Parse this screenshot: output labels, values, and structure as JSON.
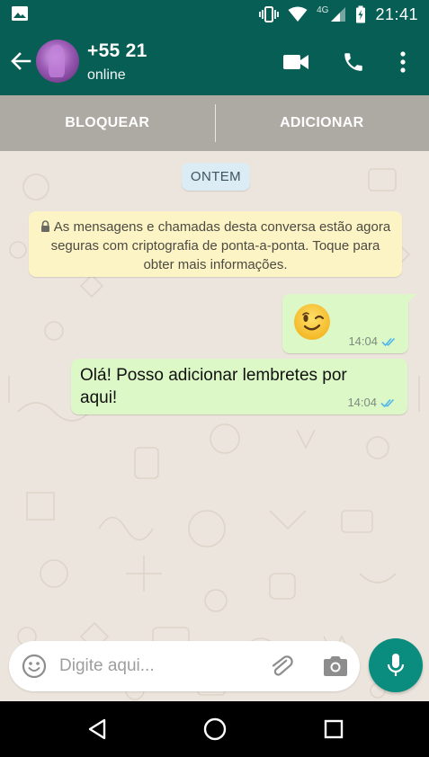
{
  "status_bar": {
    "network": "4G",
    "time": "21:41"
  },
  "header": {
    "contact_name": "+55 21",
    "contact_status": "online"
  },
  "actions": {
    "block_label": "BLOQUEAR",
    "add_label": "ADICIONAR"
  },
  "chat": {
    "date_label": "ONTEM",
    "encryption_notice": "As mensagens e chamadas desta conversa estão agora seguras com criptografia de ponta-a-ponta. Toque para obter mais informações.",
    "messages": [
      {
        "type": "emoji",
        "emoji": "wink",
        "time": "14:04",
        "status": "read"
      },
      {
        "type": "text",
        "text": "Olá! Posso adicionar lembretes por aqui!",
        "time": "14:04",
        "status": "read"
      }
    ]
  },
  "input": {
    "placeholder": "Digite aqui..."
  },
  "colors": {
    "header": "#075e54",
    "bubble_out": "#dcf8c6",
    "notice": "#fdf4c5",
    "date_chip": "#dcecf4",
    "fab": "#0a8c7e",
    "read_ticks": "#4fb6ec"
  }
}
